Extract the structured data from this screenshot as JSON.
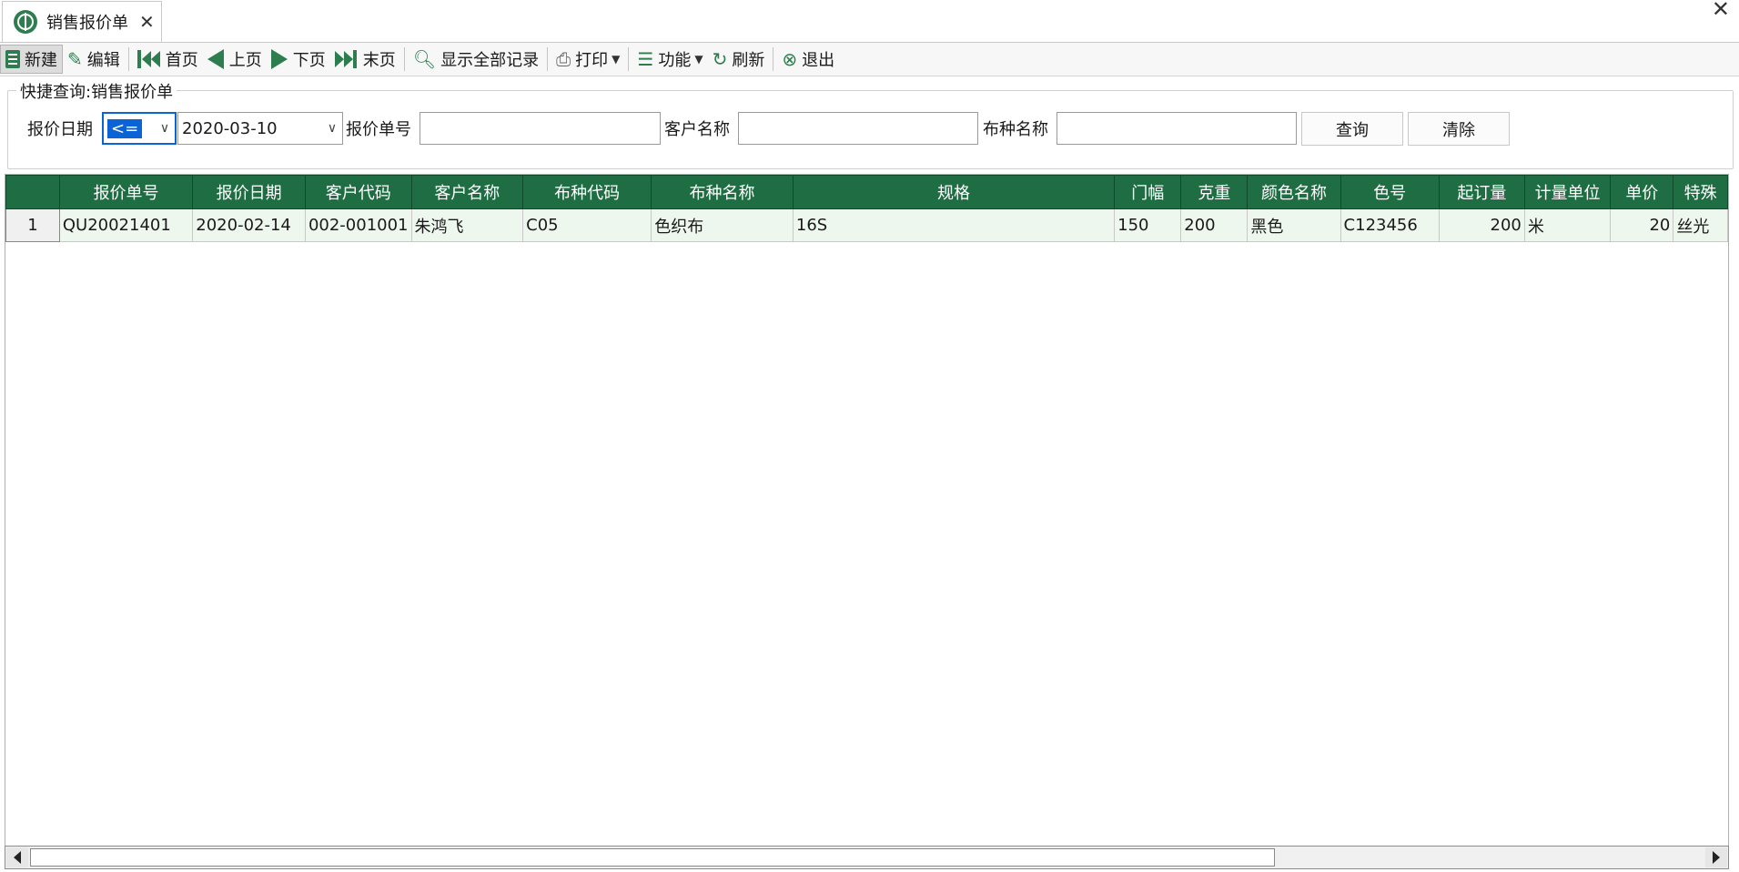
{
  "tab": {
    "title": "销售报价单",
    "close": "✕"
  },
  "window": {
    "close": "✕"
  },
  "toolbar": {
    "new": "新建",
    "edit": "编辑",
    "first": "首页",
    "prev": "上页",
    "next": "下页",
    "last": "末页",
    "show_all": "显示全部记录",
    "print": "打印",
    "function": "功能",
    "refresh": "刷新",
    "exit": "退出"
  },
  "query": {
    "title": "快捷查询:销售报价单",
    "date_label": "报价日期",
    "operator": "<=",
    "date_value": "2020-03-10",
    "order_no_label": "报价单号",
    "order_no_value": "",
    "customer_label": "客户名称",
    "customer_value": "",
    "fabric_label": "布种名称",
    "fabric_value": "",
    "search_button": "查询",
    "clear_button": "清除"
  },
  "grid": {
    "columns": [
      "报价单号",
      "报价日期",
      "客户代码",
      "客户名称",
      "布种代码",
      "布种名称",
      "规格",
      "门幅",
      "克重",
      "颜色名称",
      "色号",
      "起订量",
      "计量单位",
      "单价",
      "特殊"
    ],
    "rows": [
      {
        "index": "1",
        "cells": [
          "QU20021401",
          "2020-02-14",
          "002-001001",
          "朱鸿飞",
          "C05",
          "色织布",
          "16S",
          "150",
          "200",
          "黑色",
          "C123456",
          "200",
          "米",
          "20",
          "丝光"
        ]
      }
    ]
  },
  "colors": {
    "header_bg": "#1f6e43",
    "accent": "#2e7d4f",
    "selection": "#0a64d6"
  }
}
